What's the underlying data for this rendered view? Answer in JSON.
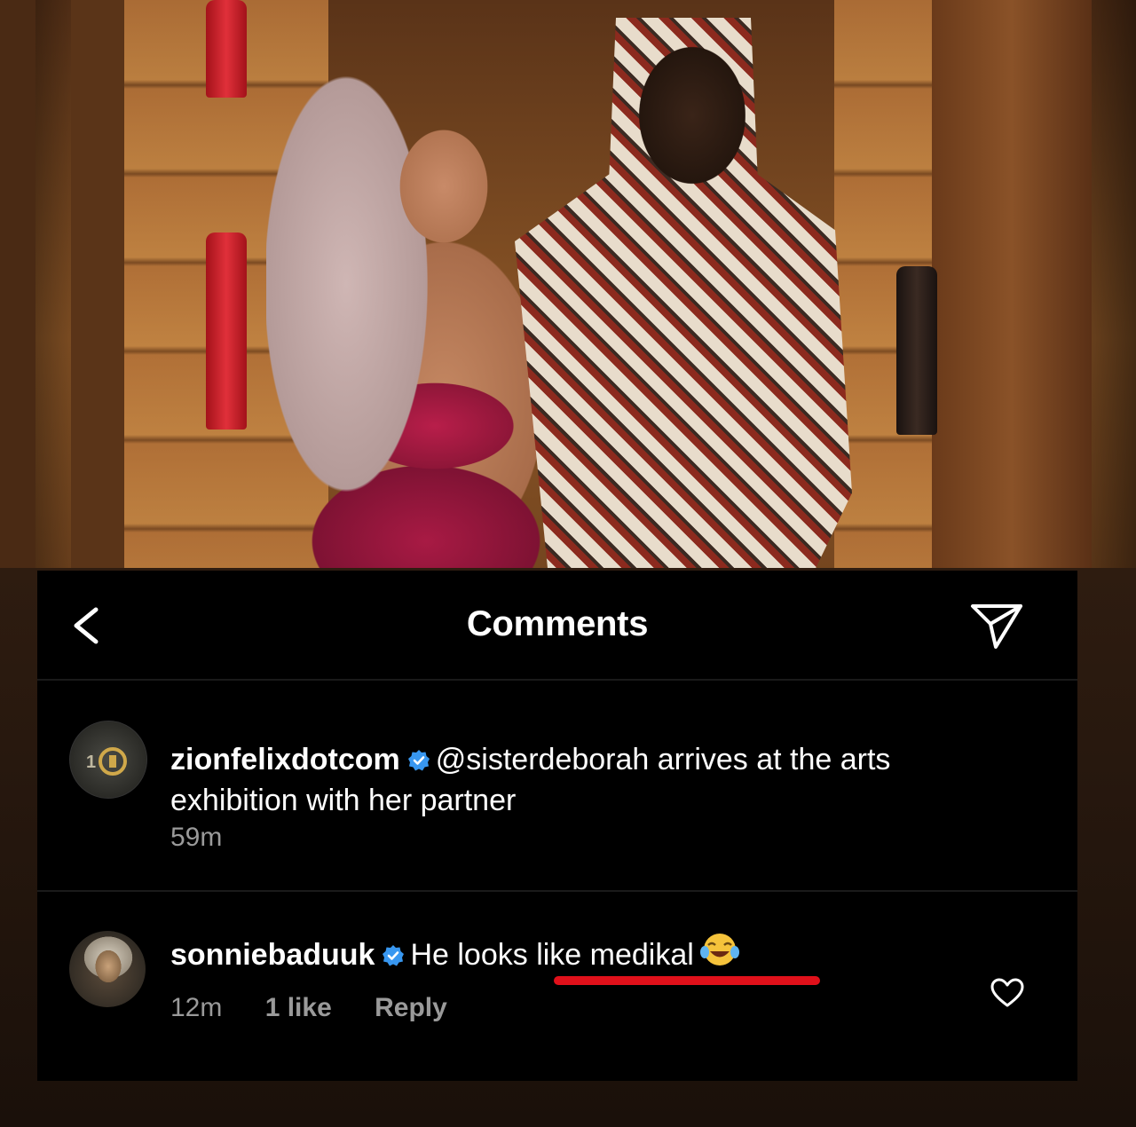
{
  "header": {
    "title": "Comments",
    "back_icon": "chevron-left-icon",
    "share_icon": "send-icon"
  },
  "comments": [
    {
      "username": "zionfelixdotcom",
      "verified": true,
      "text_line1": "@sisterdeborah arrives at the arts",
      "text_line2": "exhibition with her partner",
      "time": "59m"
    },
    {
      "username": "sonniebaduuk",
      "verified": true,
      "text": "He looks like medikal",
      "emoji": "face-with-tears-of-joy",
      "time": "12m",
      "likes": "1 like",
      "reply_label": "Reply",
      "highlight_color": "#e0101a"
    }
  ],
  "colors": {
    "panel_bg": "#000000",
    "text": "#ffffff",
    "meta": "#9a9a9a",
    "verified": "#3897f0"
  }
}
